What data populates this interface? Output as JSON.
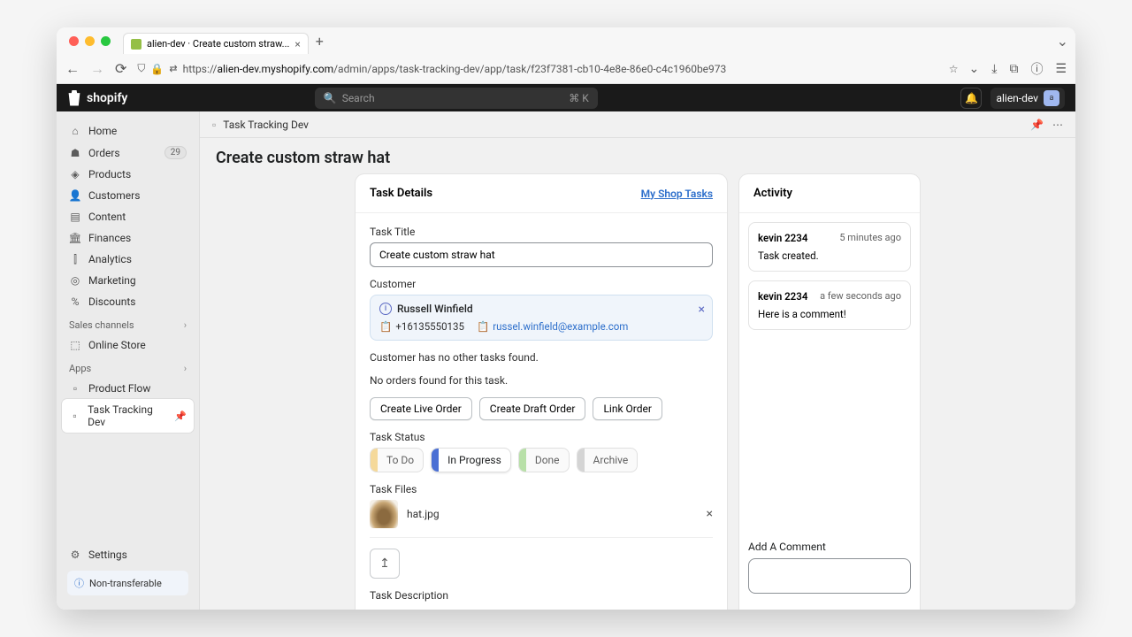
{
  "browser": {
    "tab_title": "alien-dev · Create custom straw...",
    "url_prefix": "https://",
    "url_domain": "alien-dev.myshopify.com",
    "url_path": "/admin/apps/task-tracking-dev/app/task/f23f7381-cb10-4e8e-86e0-c4c1960be973"
  },
  "header": {
    "brand": "shopify",
    "search_placeholder": "Search",
    "search_shortcut": "⌘ K",
    "store_name": "alien-dev",
    "store_initial": "a"
  },
  "sidebar": {
    "items": [
      {
        "label": "Home",
        "icon": "home"
      },
      {
        "label": "Orders",
        "icon": "orders",
        "badge": "29"
      },
      {
        "label": "Products",
        "icon": "products"
      },
      {
        "label": "Customers",
        "icon": "customers"
      },
      {
        "label": "Content",
        "icon": "content"
      },
      {
        "label": "Finances",
        "icon": "finances"
      },
      {
        "label": "Analytics",
        "icon": "analytics"
      },
      {
        "label": "Marketing",
        "icon": "marketing"
      },
      {
        "label": "Discounts",
        "icon": "discounts"
      }
    ],
    "sales_channels_label": "Sales channels",
    "online_store": "Online Store",
    "apps_label": "Apps",
    "app_items": [
      {
        "label": "Product Flow"
      },
      {
        "label": "Task Tracking Dev",
        "active": true
      }
    ],
    "settings": "Settings",
    "nontransferable": "Non-transferable"
  },
  "page": {
    "breadcrumb": "Task Tracking Dev",
    "title": "Create custom straw hat"
  },
  "details": {
    "header": "Task Details",
    "link": "My Shop Tasks",
    "task_title_label": "Task Title",
    "task_title_value": "Create custom straw hat",
    "customer_label": "Customer",
    "customer_name": "Russell Winfield",
    "customer_phone": "+16135550135",
    "customer_email": "russel.winfield@example.com",
    "no_other_tasks": "Customer has no other tasks found.",
    "no_orders": "No orders found for this task.",
    "btn_live": "Create Live Order",
    "btn_draft": "Create Draft Order",
    "btn_link": "Link Order",
    "status_label": "Task Status",
    "status": {
      "todo": "To Do",
      "progress": "In Progress",
      "done": "Done",
      "archive": "Archive"
    },
    "files_label": "Task Files",
    "file_name": "hat.jpg",
    "description_label": "Task Description"
  },
  "activity": {
    "header": "Activity",
    "items": [
      {
        "who": "kevin 2234",
        "when": "5 minutes ago",
        "text": "Task created."
      },
      {
        "who": "kevin 2234",
        "when": "a few seconds ago",
        "text": "Here is a comment!"
      }
    ],
    "comment_label": "Add A Comment"
  }
}
